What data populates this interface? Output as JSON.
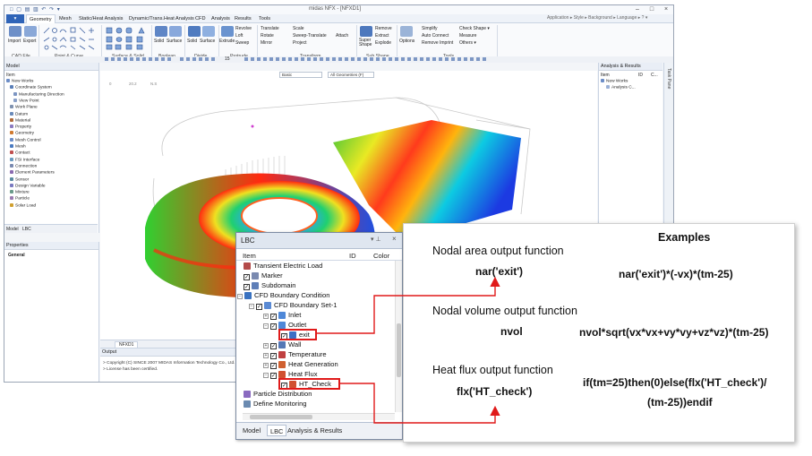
{
  "window": {
    "title": "midas NFX - [NFXD1]",
    "buttons": [
      "–",
      "□",
      "×"
    ],
    "quick_access": "□ ▢ ▤ ▥ ↶ ↷ ▾"
  },
  "menu": {
    "file": "▾",
    "items": [
      "Geometry",
      "Mesh",
      "Static/Heat Analysis",
      "Dynamic/Trans.Heat Analysis",
      "CFD",
      "Analysis",
      "Results",
      "Tools"
    ],
    "right": "Application ▸ Style ▸ Background ▸ Language ▸ ? ▾"
  },
  "ribbon": {
    "groups": [
      {
        "label": "CAD File",
        "buttons": [
          "Import",
          "Export"
        ]
      },
      {
        "label": "Point & Curve",
        "buttons": []
      },
      {
        "label": "Surface & Solid",
        "buttons": []
      },
      {
        "label": "Boolean",
        "buttons": [
          "Solid",
          "Surface"
        ]
      },
      {
        "label": "Divide",
        "buttons": [
          "Solid",
          "Surface"
        ]
      },
      {
        "label": "Protrude",
        "buttons": [
          "Extrude",
          "Revolve",
          "Loft",
          "Sweep"
        ]
      },
      {
        "label": "Transform",
        "buttons": [
          "Translate",
          "Rotate",
          "Mirror",
          "Scale",
          "Sweep-Translate",
          "Project",
          "Attach"
        ]
      },
      {
        "label": "Sub Shape",
        "buttons": [
          "Super Shape",
          "Remove",
          "Extract",
          "Explode"
        ]
      },
      {
        "label": "Tools",
        "buttons": [
          "Options",
          "Simplify",
          "Auto Connect",
          "Remove Imprint",
          "Check Shape ▾",
          "Measure",
          "Others ▾"
        ]
      }
    ],
    "zoom_value": "15"
  },
  "viewport": {
    "combo_basic": "Basic",
    "combo_geometries": "All Geometries (F)",
    "ruler": [
      "0",
      "20.2",
      "N.S"
    ]
  },
  "model_panel": {
    "title": "Model",
    "column": "Item",
    "items": [
      "New Works",
      "Coordinate System",
      "Manufacturing Direction",
      "View Point",
      "Work Plane",
      "Datum",
      "Material",
      "Property",
      "Geometry",
      "Mesh Control",
      "Mesh",
      "Contact",
      "FSI Interface",
      "Connection",
      "Element Parameters",
      "Sensor",
      "Design Variable",
      "Mixture",
      "Particle",
      "Solar Load"
    ],
    "tabs": [
      "Model",
      "LBC"
    ]
  },
  "properties_panel": {
    "title": "Properties",
    "general": "General"
  },
  "results_panel": {
    "title": "Analysis & Results",
    "columns": [
      "Item",
      "ID",
      "C..."
    ],
    "items": [
      "New Works",
      "Analysis C..."
    ]
  },
  "task_pane": {
    "label": "Task Pane"
  },
  "doc_tab": {
    "label": "NFXD1"
  },
  "output": {
    "title": "Output",
    "lines": [
      "> Copyright (C) SINCE 2007 MIDAS Information Technology Co., Ltd. ...",
      "> License has been certified."
    ]
  },
  "lbc": {
    "title": "LBC",
    "columns": [
      "Item",
      "ID",
      "Color"
    ],
    "items": [
      {
        "label": "Transient Electric Load",
        "depth": 0
      },
      {
        "label": "Marker",
        "depth": 0
      },
      {
        "label": "Subdomain",
        "depth": 0
      },
      {
        "label": "CFD Boundary Condition",
        "depth": 0
      },
      {
        "label": "CFD Boundary Set-1",
        "depth": 1
      },
      {
        "label": "Inlet",
        "depth": 2
      },
      {
        "label": "Outlet",
        "depth": 2
      },
      {
        "label": "exit",
        "depth": 3
      },
      {
        "label": "Wall",
        "depth": 2
      },
      {
        "label": "Temperature",
        "depth": 2
      },
      {
        "label": "Heat Generation",
        "depth": 2
      },
      {
        "label": "Heat Flux",
        "depth": 2
      },
      {
        "label": "HT_Check",
        "depth": 3
      },
      {
        "label": "Particle Distribution",
        "depth": 0
      },
      {
        "label": "Define Monitoring",
        "depth": 0
      }
    ],
    "tabs": [
      "Model",
      "LBC",
      "Analysis & Results"
    ]
  },
  "examples": {
    "heading": "Examples",
    "nodal_area_label": "Nodal area output function",
    "nodal_area_func": "nar('exit')",
    "nodal_area_example": "nar('exit')*(-vx)*(tm-25)",
    "nodal_volume_label": "Nodal volume output function",
    "nodal_volume_func": "nvol",
    "nodal_volume_example": "nvol*sqrt(vx*vx+vy*vy+vz*vz)*(tm-25)",
    "heat_flux_label": "Heat flux output function",
    "heat_flux_func": "flx('HT_check')",
    "heat_flux_example_1": "if(tm=25)then(0)else(flx('HT_check')/",
    "heat_flux_example_2": "(tm-25))endif"
  },
  "colors": {
    "highlight": "#e01a1a",
    "accent": "#2f64b8"
  }
}
